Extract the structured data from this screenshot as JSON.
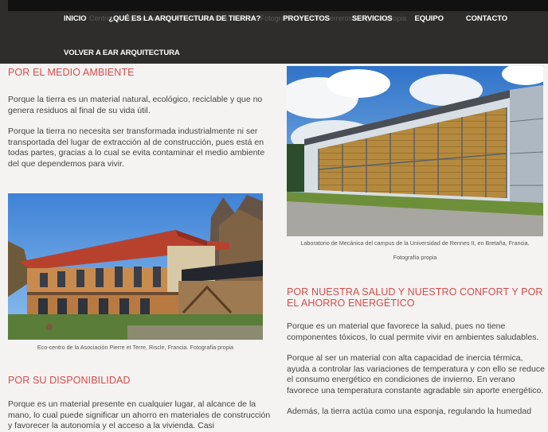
{
  "nav": {
    "items": [
      "Inicio",
      "¿Qué es la arquitectura de tierra?",
      "Proyectos",
      "Servicios",
      "Equipo",
      "Contacto"
    ],
    "back": "Volver a EAR Arquitectura",
    "ghost": "Centro de arquitectura de tierra en Montiers, Francia. Fotografía de Adam Ferreros fotografía propia"
  },
  "sections": {
    "environment": {
      "title": "POR EL MEDIO AMBIENTE",
      "p1": "Porque la tierra es un material natural, ecológico, reciclable y que no genera residuos al final de su vida útil.",
      "p2": "Porque la tierra no necesita ser transformada industrialmente ni ser transportada del lugar de extracción al de construcción, pues está en todas partes, gracias a lo cual se evita contaminar el medio ambiente del que dependemos para vivir."
    },
    "eco_caption": "Eco-centro de la Asociación Pierre et Terre, Riscle, Francia. Fotografía propia",
    "availability": {
      "title": "POR SU DISPONIBILIDAD",
      "p1": "Porque es un material presente en cualquier lugar, al alcance de la mano, lo cual puede significar un ahorro en materiales de construcción y favorecer la autonomía y el acceso a la vivienda. Casi"
    },
    "lab_caption_1": "Laboratorio de Mecánica del campus de la Universidad de Rennes II, en Bretaña, Francia.",
    "lab_caption_2": "Fotografía propia",
    "health": {
      "title": "POR NUESTRA SALUD Y NUESTRO CONFORT Y POR EL AHORRO ENERGÉTICO",
      "p1": "Porque es un material que favorece la salud, pues no tiene componentes tóxicos, lo cual permite vivir en ambientes saludables.",
      "p2": "Porque al ser un material con alta capacidad de inercia térmica, ayuda a controlar las variaciones de temperatura y con ello se reduce el consumo energético en condiciones de invierno. En verano favorece una temperatura constante agradable sin aporte energético.",
      "p3": "Además, la tierra actúa como una esponja, regulando la humedad"
    }
  }
}
